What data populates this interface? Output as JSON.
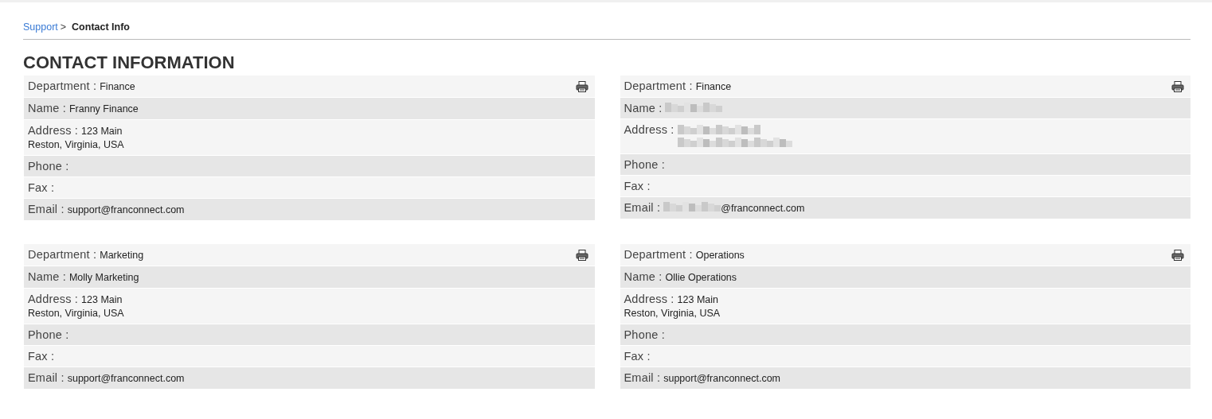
{
  "breadcrumb": {
    "items": [
      {
        "label": "Support",
        "kind": "link"
      },
      {
        "label": "Contact Info",
        "kind": "current"
      }
    ],
    "separator": ">"
  },
  "title": "CONTACT INFORMATION",
  "contacts": [
    {
      "fields": [
        {
          "kind": "department",
          "label": "Department :",
          "value": "Finance"
        },
        {
          "kind": "text",
          "label": "Name :",
          "value": "Franny Finance"
        },
        {
          "kind": "address",
          "label": "Address :",
          "lines": [
            "123 Main",
            "Reston, Virginia, USA"
          ]
        },
        {
          "kind": "text",
          "label": "Phone :"
        },
        {
          "kind": "text",
          "label": "Fax :"
        },
        {
          "kind": "text",
          "label": "Email :",
          "value": "support@franconnect.com"
        }
      ]
    },
    {
      "fields": [
        {
          "kind": "department",
          "label": "Department :",
          "value": "Finance"
        },
        {
          "kind": "text",
          "label": "Name :",
          "redacted": true
        },
        {
          "kind": "address",
          "label": "Address :",
          "redacted": true
        },
        {
          "kind": "text",
          "label": "Phone :"
        },
        {
          "kind": "text",
          "label": "Fax :"
        },
        {
          "kind": "text",
          "label": "Email :",
          "redacted": true,
          "value": "@franconnect.com"
        }
      ]
    },
    {
      "fields": [
        {
          "kind": "department",
          "label": "Department :",
          "value": "Marketing"
        },
        {
          "kind": "text",
          "label": "Name :",
          "value": "Molly Marketing"
        },
        {
          "kind": "address",
          "label": "Address :",
          "lines": [
            "123 Main",
            "Reston, Virginia, USA"
          ]
        },
        {
          "kind": "text",
          "label": "Phone :"
        },
        {
          "kind": "text",
          "label": "Fax :"
        },
        {
          "kind": "text",
          "label": "Email :",
          "value": "support@franconnect.com"
        }
      ]
    },
    {
      "fields": [
        {
          "kind": "department",
          "label": "Department :",
          "value": "Operations"
        },
        {
          "kind": "text",
          "label": "Name :",
          "value": "Ollie Operations"
        },
        {
          "kind": "address",
          "label": "Address :",
          "lines": [
            "123 Main",
            "Reston, Virginia, USA"
          ]
        },
        {
          "kind": "text",
          "label": "Phone :"
        },
        {
          "kind": "text",
          "label": "Fax :"
        },
        {
          "kind": "text",
          "label": "Email :",
          "value": "support@franconnect.com"
        }
      ]
    }
  ]
}
